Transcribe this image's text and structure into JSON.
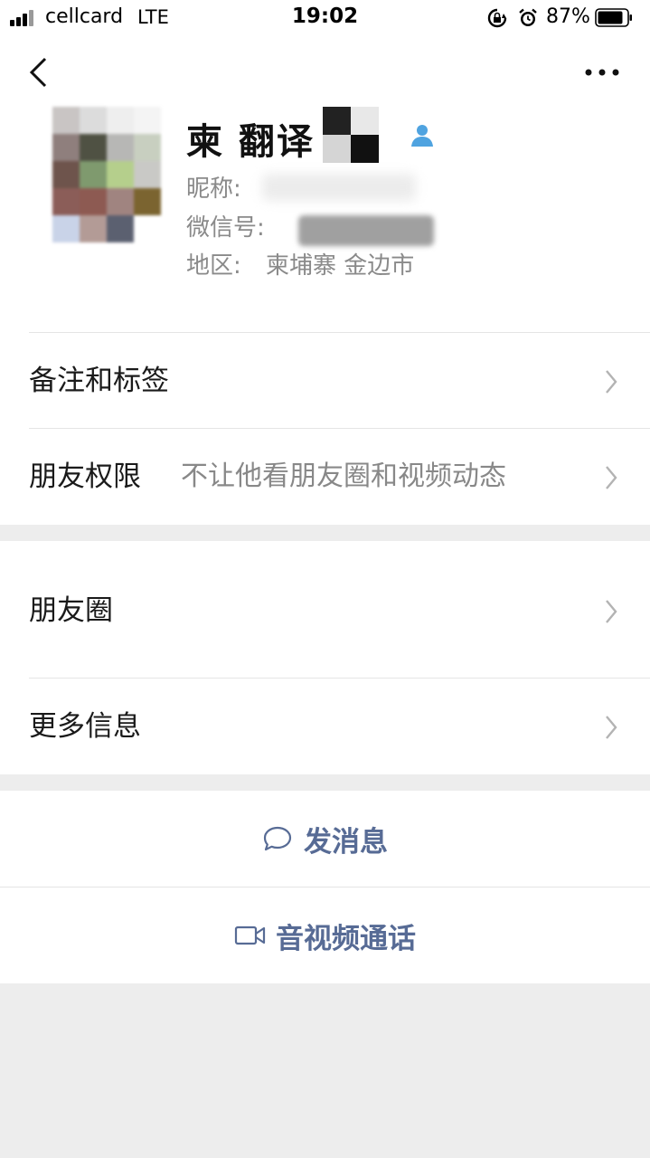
{
  "status_bar": {
    "carrier": "cellcard",
    "network": "LTE",
    "time": "19:02",
    "battery_percent": "87%",
    "battery_level": 0.87
  },
  "profile": {
    "name": "柬 翻译",
    "nickname_label": "昵称:",
    "wechat_id_label": "微信号:",
    "region_label": "地区:",
    "region_value": "柬埔寨 金边市"
  },
  "list": {
    "remarks_tags": "备注和标签",
    "friend_permissions": "朋友权限",
    "friend_permissions_value": "不让他看朋友圈和视频动态",
    "moments": "朋友圈",
    "more_info": "更多信息"
  },
  "actions": {
    "send_message": "发消息",
    "voice_video_call": "音视频通话"
  },
  "colors": {
    "link_blue": "#576b95",
    "background": "#ededed",
    "contact_icon": "#4fa3e0"
  },
  "icons": [
    "back-icon",
    "more-icon",
    "contact-icon",
    "chevron-right-icon",
    "chat-bubble-icon",
    "video-camera-icon"
  ]
}
